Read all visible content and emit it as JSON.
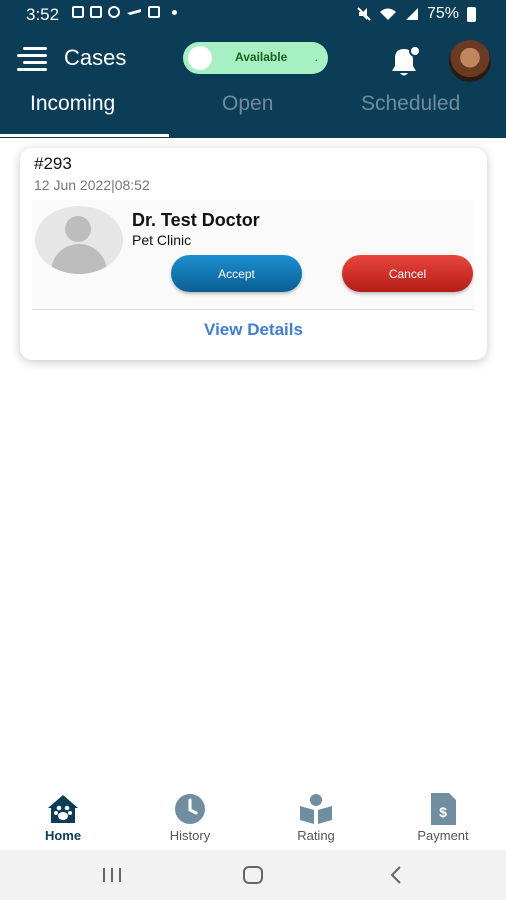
{
  "status_bar": {
    "time": "3:52",
    "battery": "75%",
    "icons": [
      "notification-icon",
      "calendar-icon",
      "chat-icon",
      "flight-icon",
      "image-icon",
      "dot-icon",
      "mute-icon",
      "wifi-icon",
      "signal-icon",
      "battery-icon"
    ]
  },
  "app_bar": {
    "title": "Cases",
    "availability_label": "Available",
    "availability_dot": ".",
    "accent": "#0b3d56",
    "toggle_color": "#a6f0c2"
  },
  "tabs": [
    {
      "label": "Incoming",
      "active": true
    },
    {
      "label": "Open",
      "active": false
    },
    {
      "label": "Scheduled",
      "active": false
    }
  ],
  "case_card": {
    "case_id": "#293",
    "date": "12 Jun 2022|08:52",
    "doctor_name": "Dr. Test Doctor",
    "clinic": "Pet Clinic",
    "accept_label": "Accept",
    "cancel_label": "Cancel",
    "view_details_label": "View Details",
    "accept_color": "#1c8fd2",
    "cancel_color": "#d6302a"
  },
  "bottom_nav": [
    {
      "label": "Home",
      "icon": "home-pet-icon",
      "active": true
    },
    {
      "label": "History",
      "icon": "clock-icon",
      "active": false
    },
    {
      "label": "Rating",
      "icon": "rating-icon",
      "active": false
    },
    {
      "label": "Payment",
      "icon": "invoice-dollar-icon",
      "active": false
    }
  ],
  "system_nav": [
    "recents-icon",
    "home-icon",
    "back-icon"
  ]
}
